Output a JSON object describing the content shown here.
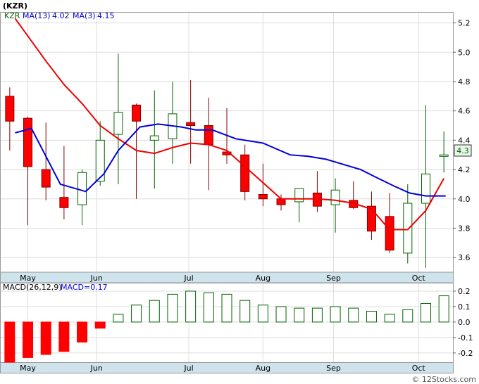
{
  "header": {
    "title": "(KZR)"
  },
  "chart_data": [
    {
      "type": "candlestick",
      "legend": {
        "symbol": "KZR",
        "ma13_label": "MA(13)",
        "ma13_value": "4.02",
        "ma3_label": "MA(3)",
        "ma3_value": "4.15"
      },
      "x_tick_labels": [
        "May",
        "Jun",
        "Jul",
        "Aug",
        "Sep",
        "Oct"
      ],
      "y_ticks": [
        3.6,
        3.8,
        4.0,
        4.2,
        4.4,
        4.6,
        4.8,
        5.0,
        5.2
      ],
      "y_tick_labels": [
        "3.6",
        "3.8",
        "4.0",
        "4.2",
        "4.4",
        "4.6",
        "4.8",
        "5.0",
        "5.2"
      ],
      "ylim": [
        3.5,
        5.27
      ],
      "last_price_label": "4.3",
      "grid": true,
      "candles": [
        {
          "o": 4.7,
          "h": 4.76,
          "l": 4.33,
          "c": 4.53
        },
        {
          "o": 4.55,
          "h": 4.56,
          "l": 3.82,
          "c": 4.22
        },
        {
          "o": 4.2,
          "h": 4.52,
          "l": 3.99,
          "c": 4.08
        },
        {
          "o": 4.01,
          "h": 4.36,
          "l": 3.86,
          "c": 3.94
        },
        {
          "o": 3.96,
          "h": 4.2,
          "l": 3.82,
          "c": 4.18
        },
        {
          "o": 4.12,
          "h": 4.53,
          "l": 4.09,
          "c": 4.4
        },
        {
          "o": 4.44,
          "h": 4.99,
          "l": 4.1,
          "c": 4.59
        },
        {
          "o": 4.64,
          "h": 4.65,
          "l": 4.0,
          "c": 4.53
        },
        {
          "o": 4.4,
          "h": 4.74,
          "l": 4.07,
          "c": 4.43
        },
        {
          "o": 4.41,
          "h": 4.8,
          "l": 4.24,
          "c": 4.58
        },
        {
          "o": 4.52,
          "h": 4.81,
          "l": 4.24,
          "c": 4.5
        },
        {
          "o": 4.5,
          "h": 4.69,
          "l": 4.06,
          "c": 4.37
        },
        {
          "o": 4.32,
          "h": 4.62,
          "l": 4.24,
          "c": 4.3
        },
        {
          "o": 4.3,
          "h": 4.37,
          "l": 3.99,
          "c": 4.05
        },
        {
          "o": 4.03,
          "h": 4.24,
          "l": 3.95,
          "c": 4.0
        },
        {
          "o": 4.0,
          "h": 4.03,
          "l": 3.92,
          "c": 3.96
        },
        {
          "o": 3.98,
          "h": 4.07,
          "l": 3.84,
          "c": 4.07
        },
        {
          "o": 4.04,
          "h": 4.19,
          "l": 3.91,
          "c": 3.95
        },
        {
          "o": 3.96,
          "h": 4.14,
          "l": 3.77,
          "c": 4.06
        },
        {
          "o": 3.99,
          "h": 4.12,
          "l": 3.93,
          "c": 3.94
        },
        {
          "o": 3.95,
          "h": 4.05,
          "l": 3.72,
          "c": 3.78
        },
        {
          "o": 3.88,
          "h": 4.04,
          "l": 3.63,
          "c": 3.65
        },
        {
          "o": 3.63,
          "h": 4.1,
          "l": 3.56,
          "c": 3.97
        },
        {
          "o": 3.97,
          "h": 4.64,
          "l": 3.53,
          "c": 4.17
        },
        {
          "o": 4.29,
          "h": 4.46,
          "l": 4.18,
          "c": 4.3
        }
      ],
      "ma13": [
        {
          "i": 0.3,
          "v": 5.23
        },
        {
          "i": 2,
          "v": 4.94
        },
        {
          "i": 3,
          "v": 4.78
        },
        {
          "i": 4,
          "v": 4.65
        },
        {
          "i": 5,
          "v": 4.5
        },
        {
          "i": 6,
          "v": 4.41
        },
        {
          "i": 7,
          "v": 4.33
        },
        {
          "i": 8,
          "v": 4.31
        },
        {
          "i": 9,
          "v": 4.35
        },
        {
          "i": 10,
          "v": 4.38
        },
        {
          "i": 11,
          "v": 4.37
        },
        {
          "i": 12,
          "v": 4.33
        },
        {
          "i": 13,
          "v": 4.22
        },
        {
          "i": 14,
          "v": 4.11
        },
        {
          "i": 15,
          "v": 4.0
        },
        {
          "i": 16,
          "v": 4.0
        },
        {
          "i": 17,
          "v": 4.0
        },
        {
          "i": 18,
          "v": 3.99
        },
        {
          "i": 19,
          "v": 3.97
        },
        {
          "i": 20,
          "v": 3.93
        },
        {
          "i": 21,
          "v": 3.79
        },
        {
          "i": 22,
          "v": 3.79
        },
        {
          "i": 23,
          "v": 3.92
        },
        {
          "i": 24,
          "v": 4.14
        }
      ],
      "ma3": [
        {
          "i": 0.3,
          "v": 4.45
        },
        {
          "i": 1.2,
          "v": 4.48
        },
        {
          "i": 2.8,
          "v": 4.1
        },
        {
          "i": 4.2,
          "v": 4.05
        },
        {
          "i": 5.2,
          "v": 4.17
        },
        {
          "i": 6,
          "v": 4.33
        },
        {
          "i": 7.2,
          "v": 4.49
        },
        {
          "i": 8.2,
          "v": 4.51
        },
        {
          "i": 9.5,
          "v": 4.49
        },
        {
          "i": 10.3,
          "v": 4.47
        },
        {
          "i": 11.2,
          "v": 4.47
        },
        {
          "i": 12.5,
          "v": 4.41
        },
        {
          "i": 14,
          "v": 4.38
        },
        {
          "i": 15.5,
          "v": 4.3
        },
        {
          "i": 16.5,
          "v": 4.29
        },
        {
          "i": 17.5,
          "v": 4.27
        },
        {
          "i": 18.3,
          "v": 4.24
        },
        {
          "i": 19.4,
          "v": 4.2
        },
        {
          "i": 20.2,
          "v": 4.15
        },
        {
          "i": 21.2,
          "v": 4.09
        },
        {
          "i": 22.1,
          "v": 4.04
        },
        {
          "i": 23,
          "v": 4.02
        },
        {
          "i": 24.1,
          "v": 4.02
        }
      ],
      "colors": {
        "up_body": "#ffffff",
        "up_outline": "#006400",
        "down_body": "#ff0000",
        "down_outline": "#800000",
        "ma13": "#0000dd",
        "ma3": "#ee0000",
        "grid": "#dddddd",
        "axis_bar": "#cfe3ec"
      }
    },
    {
      "type": "bar",
      "legend": {
        "label": "MACD(26,12,9)",
        "value_label": "MACD=0.17"
      },
      "y_ticks": [
        -0.2,
        -0.1,
        0.0,
        0.1,
        0.2
      ],
      "y_tick_labels": [
        "-0.2",
        "-0.1",
        "0.0",
        "0.1",
        "0.2"
      ],
      "ylim": [
        -0.26,
        0.25
      ],
      "x_tick_labels": [
        "May",
        "Jun",
        "Jul",
        "Aug",
        "Sep",
        "Oct"
      ],
      "values": [
        -0.26,
        -0.23,
        -0.21,
        -0.19,
        -0.13,
        -0.04,
        0.05,
        0.11,
        0.14,
        0.18,
        0.2,
        0.19,
        0.18,
        0.14,
        0.11,
        0.1,
        0.09,
        0.09,
        0.1,
        0.09,
        0.07,
        0.05,
        0.08,
        0.12,
        0.17
      ],
      "colors": {
        "positive_outline": "#006400",
        "negative_fill": "#ff0000"
      }
    }
  ],
  "watermark": "© 12Stocks.com"
}
